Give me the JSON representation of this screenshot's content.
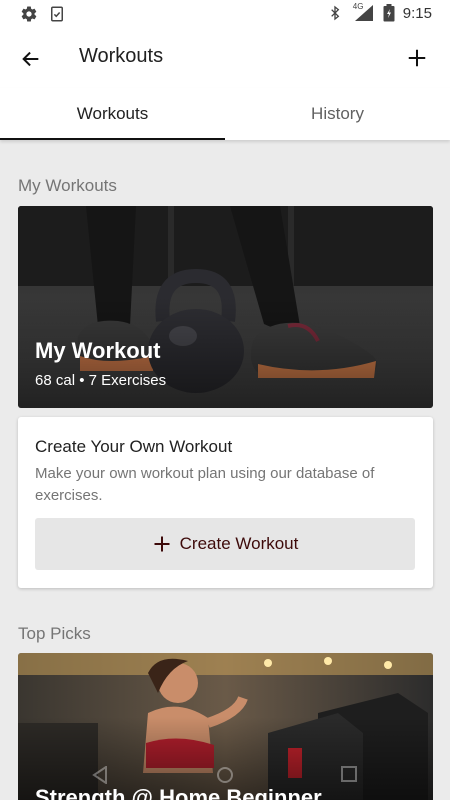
{
  "status_bar": {
    "time": "9:15",
    "left_icons": [
      "gear-icon",
      "clipboard-check-icon"
    ],
    "right_icons": [
      "bluetooth-icon",
      "signal-4g-icon",
      "battery-icon"
    ],
    "network_label": "4G"
  },
  "app_bar": {
    "title": "Workouts",
    "back_icon": "arrow-left-icon",
    "add_icon": "plus-icon"
  },
  "tabs": [
    {
      "label": "Workouts",
      "active": true
    },
    {
      "label": "History",
      "active": false
    }
  ],
  "my_workouts": {
    "section_title": "My Workouts",
    "card": {
      "title": "My Workout",
      "meta": "68 cal • 7 Exercises"
    }
  },
  "create": {
    "title": "Create Your Own Workout",
    "description": "Make your own workout plan using our database of exercises.",
    "button_label": "Create Workout",
    "button_icon": "plus-icon",
    "accent_color": "#3d0a0a"
  },
  "top_picks": {
    "section_title": "Top Picks",
    "card": {
      "title": "Strength @ Home Beginner"
    }
  },
  "nav": {
    "icons": [
      "nav-back-icon",
      "nav-home-icon",
      "nav-recents-icon"
    ]
  }
}
